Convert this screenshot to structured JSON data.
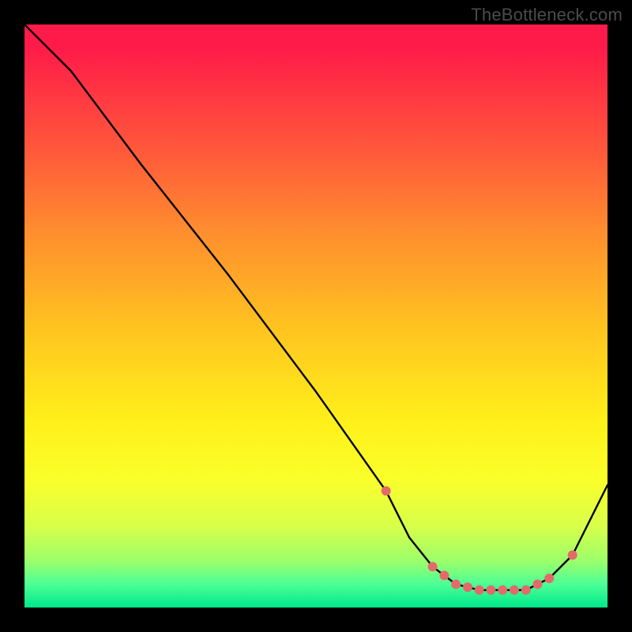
{
  "attribution": "TheBottleneck.com",
  "chart_data": {
    "type": "line",
    "title": "",
    "xlabel": "",
    "ylabel": "",
    "xlim": [
      0,
      100
    ],
    "ylim": [
      0,
      100
    ],
    "grid": false,
    "legend": false,
    "series": [
      {
        "name": "curve",
        "color": "#000000",
        "x": [
          0,
          8,
          20,
          35,
          50,
          62,
          66,
          70,
          74,
          78,
          82,
          86,
          90,
          94,
          100
        ],
        "y": [
          100,
          92,
          76,
          57,
          37,
          20,
          12,
          7,
          4,
          3,
          3,
          3,
          5,
          9,
          21
        ]
      }
    ],
    "markers": {
      "name": "highlight-dots",
      "color": "#e46a6a",
      "radius_px": 6,
      "points_idx": [
        5,
        7,
        8,
        9,
        10,
        11,
        12,
        13
      ],
      "extra_dots": [
        {
          "x": 72,
          "y": 5.5
        },
        {
          "x": 76,
          "y": 3.5
        },
        {
          "x": 80,
          "y": 3
        },
        {
          "x": 84,
          "y": 3
        },
        {
          "x": 88,
          "y": 4
        }
      ]
    }
  }
}
